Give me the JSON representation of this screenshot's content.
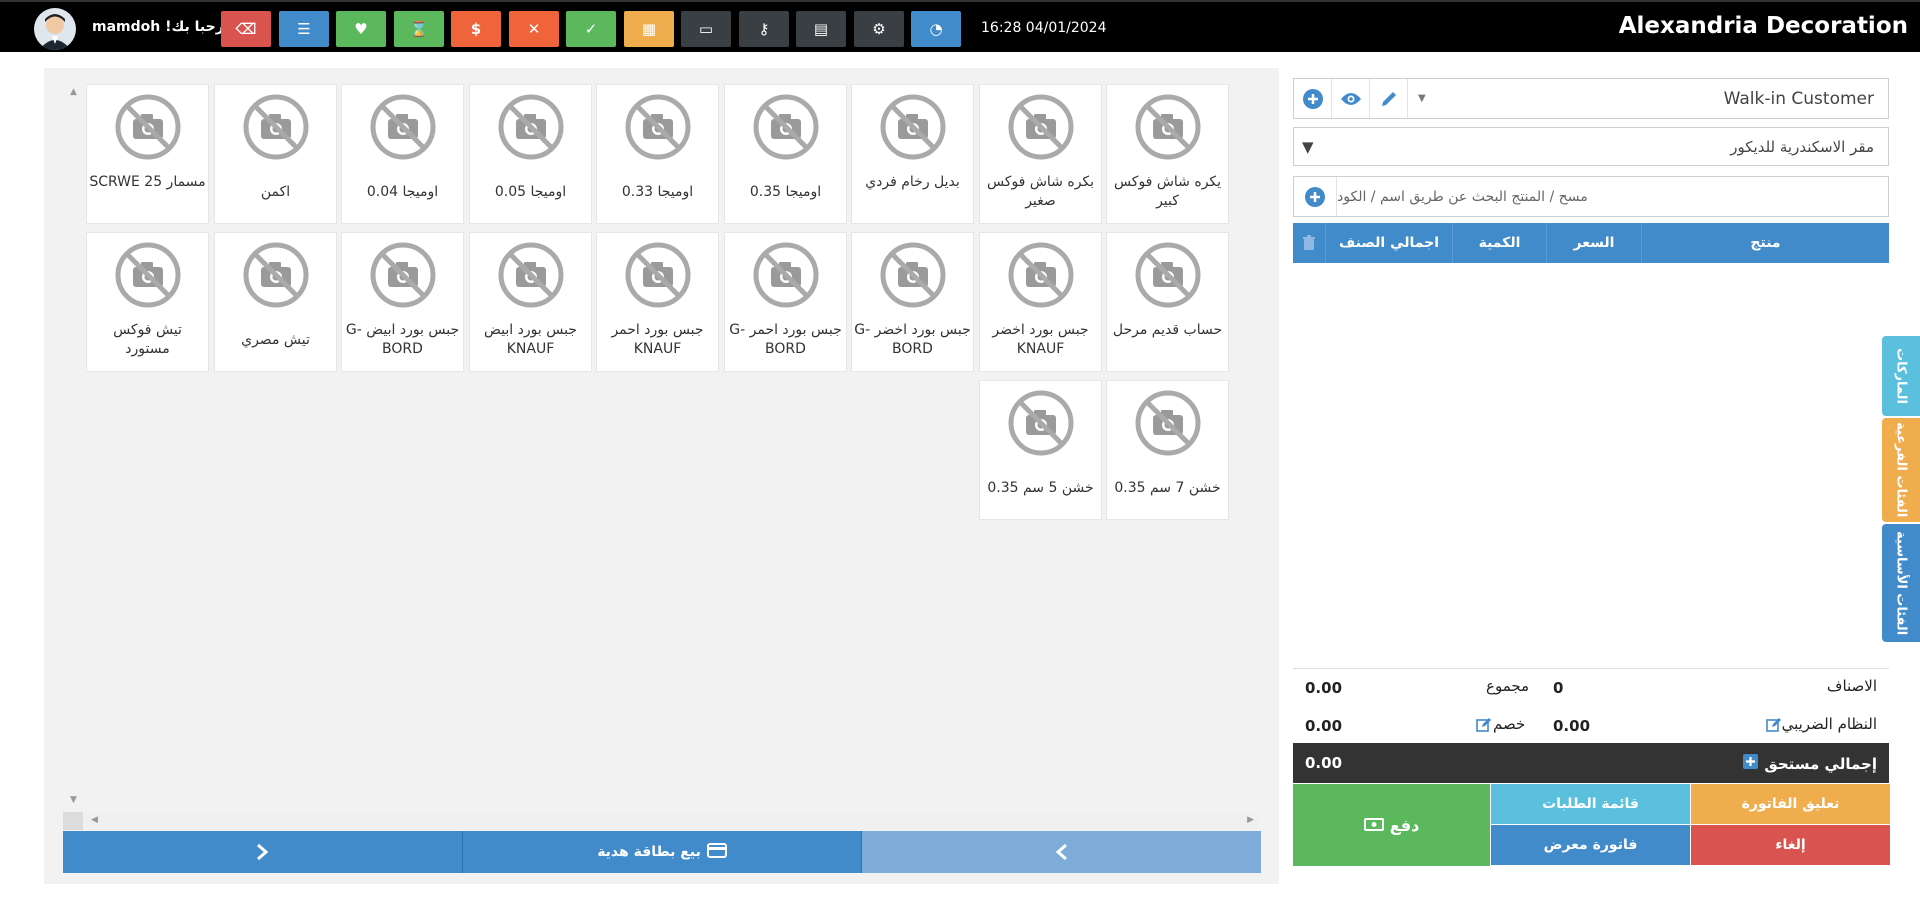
{
  "app": {
    "brand": "Alexandria Decoration",
    "welcome": "مرحبا بك! mamdoh",
    "datetime": "16:28 04/01/2024"
  },
  "toolbar": [
    {
      "name": "eraser-icon",
      "color": "#d9534f",
      "glyph": "⌫"
    },
    {
      "name": "list-icon",
      "color": "#428bca",
      "glyph": "☰"
    },
    {
      "name": "heart-icon",
      "color": "#5cb85c",
      "glyph": "♥"
    },
    {
      "name": "hourglass-icon",
      "color": "#5cb85c",
      "glyph": "⌛"
    },
    {
      "name": "dollar-icon",
      "color": "#f0643c",
      "glyph": "$"
    },
    {
      "name": "close-circle-icon",
      "color": "#f0643c",
      "glyph": "✕"
    },
    {
      "name": "check-circle-icon",
      "color": "#5cb85c",
      "glyph": "✓"
    },
    {
      "name": "grid-icon",
      "color": "#f0ad4e",
      "glyph": "▦"
    },
    {
      "name": "laptop-icon",
      "color": "#3a3f44",
      "glyph": "▭"
    },
    {
      "name": "key-icon",
      "color": "#3a3f44",
      "glyph": "⚷"
    },
    {
      "name": "calculator-icon",
      "color": "#3a3f44",
      "glyph": "▤"
    },
    {
      "name": "cogs-icon",
      "color": "#3a3f44",
      "glyph": "⚙"
    },
    {
      "name": "dashboard-icon",
      "color": "#428bca",
      "glyph": "◔"
    }
  ],
  "products": [
    {
      "name": "يكره شاش فوكس كبير"
    },
    {
      "name": "بكره شاش فوكس صغير"
    },
    {
      "name": "بديل رخام فردي"
    },
    {
      "name": "اوميجا 0.35"
    },
    {
      "name": "اوميجا 0.33"
    },
    {
      "name": "اوميجا 0.05"
    },
    {
      "name": "اوميجا 0.04"
    },
    {
      "name": "اكمن"
    },
    {
      "name": "مسمار 25 SCRWE"
    },
    {
      "name": "حساب قديم مرحل"
    },
    {
      "name": "جبس بورد اخضر KNAUF"
    },
    {
      "name": "جبس بورد اخضر -G BORD"
    },
    {
      "name": "جبس بورد احمر -G BORD"
    },
    {
      "name": "جبس بورد احمر KNAUF"
    },
    {
      "name": "جبس بورد ابيض KNAUF"
    },
    {
      "name": "جبس بورد ابيض -G BORD"
    },
    {
      "name": "تيش مصري"
    },
    {
      "name": "تيش فوكس مستورد"
    },
    {
      "name": "خشن 7 سم 0.35"
    },
    {
      "name": "خشن 5 سم 0.35"
    }
  ],
  "pager": {
    "gift_label": "بيع بطاقة هدية"
  },
  "customer": {
    "selected": "Walk-in Customer"
  },
  "warehouse": {
    "selected": "مقر الاسكندرية للديكور"
  },
  "search": {
    "placeholder": "مسح / المنتج البحث عن طريق اسم / الكود"
  },
  "table": {
    "columns": [
      "منتج",
      "السعر",
      "الكمية",
      "اجمالي الصنف"
    ]
  },
  "totals": {
    "items_label": "الاصناف",
    "items_value": "0",
    "total_label": "مجموع",
    "total_value": "0.00",
    "tax_label": "النظام الضريبي",
    "tax_value": "0.00",
    "discount_label": "خصم",
    "discount_value": "0.00",
    "grand_label": "إجمالي مستحق",
    "grand_value": "0.00"
  },
  "actions": {
    "pay": "دفع",
    "suspend": "تعليق الفاتورة",
    "orders": "قائمة الطلبات",
    "cancel": "إلغاء",
    "quote": "فاتورة معرض"
  },
  "sidetabs": [
    "الماركات",
    "الفئات الفرعية",
    "الفئات الأساسية"
  ]
}
